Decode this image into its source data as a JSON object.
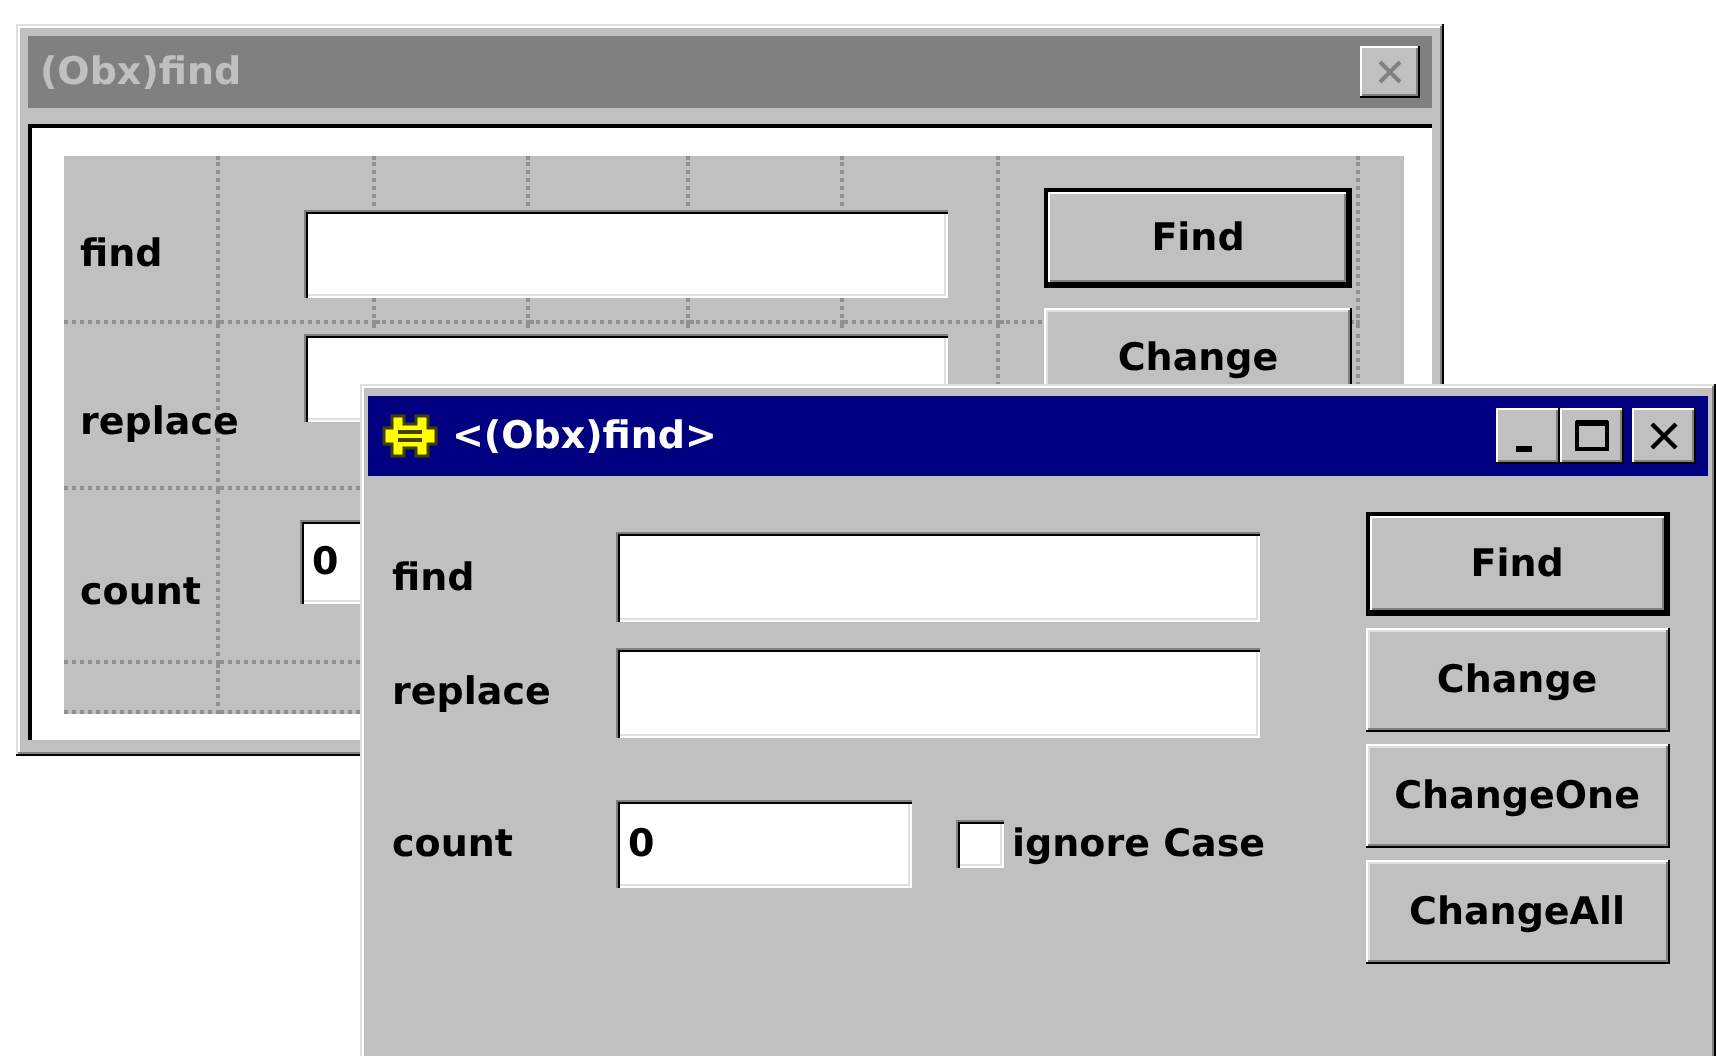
{
  "back_window": {
    "title": "(Obx)find",
    "active": false,
    "fields": [
      {
        "label": "find"
      },
      {
        "label": "replace"
      },
      {
        "label": "count",
        "value": "0"
      }
    ],
    "buttons": [
      {
        "label": "Find",
        "default": true
      },
      {
        "label": "Change",
        "default": false
      }
    ]
  },
  "front_window": {
    "title": "<(Obx)find>",
    "active": true,
    "fields": [
      {
        "label": "find"
      },
      {
        "label": "replace"
      },
      {
        "label": "count",
        "value": "0"
      }
    ],
    "checkbox": {
      "label": "ignore Case",
      "checked": false
    },
    "buttons": [
      {
        "label": "Find",
        "default": true
      },
      {
        "label": "Change",
        "default": false
      },
      {
        "label": "ChangeOne",
        "default": false
      },
      {
        "label": "ChangeAll",
        "default": false
      }
    ]
  }
}
